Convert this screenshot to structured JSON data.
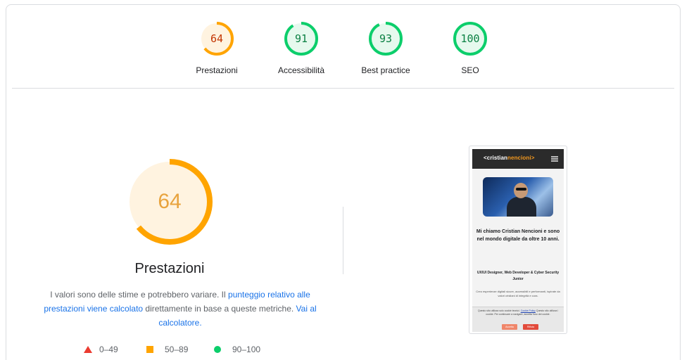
{
  "gauges": [
    {
      "id": "performance",
      "score": "64",
      "label": "Prestazioni",
      "rating": "average",
      "fraction": 0.64
    },
    {
      "id": "accessibility",
      "score": "91",
      "label": "Accessibilità",
      "rating": "pass",
      "fraction": 0.91
    },
    {
      "id": "best-practices",
      "score": "93",
      "label": "Best practice",
      "rating": "pass",
      "fraction": 0.93
    },
    {
      "id": "seo",
      "score": "100",
      "label": "SEO",
      "rating": "pass",
      "fraction": 1.0
    }
  ],
  "colors": {
    "average_stroke": "#ffa400",
    "average_fill": "#fff3e0",
    "average_text": "#c33300",
    "pass_stroke": "#0cce6b",
    "pass_fill": "#e6f9ee",
    "pass_text": "#0b8043",
    "fail": "#eb3b30",
    "link": "#1a73e8"
  },
  "main": {
    "score": "64",
    "fraction": 0.64,
    "title": "Prestazioni",
    "description": {
      "part1": "I valori sono delle stime e potrebbero variare. Il ",
      "link1": "punteggio relativo alle prestazioni viene calcolato",
      "part2": " direttamente in base a queste metriche. ",
      "link2": "Vai al calcolatore."
    }
  },
  "legend": [
    {
      "icon": "triangle-icon",
      "range": "0–49"
    },
    {
      "icon": "square-icon",
      "range": "50–89"
    },
    {
      "icon": "circle-icon",
      "range": "90–100"
    }
  ],
  "screenshot": {
    "logo_part1": "<cristian",
    "logo_part2": "nencioni>",
    "heading": "Mi chiamo Cristian Nencioni e sono nel mondo digitale da oltre 10 anni.",
    "role": "UX/UI Designer, Web Developer & Cyber Security Junior",
    "intro": "Creo esperienze digitali sicure, accessibili e performanti, ispirate da valori cristiani di integrità e cura.",
    "cookie_text_1": "Questo sito utilizza solo cookie tecnici. ",
    "cookie_link": "Cookie Policy",
    "cookie_text_2": "Questo sito utilizza i cookie. Per continuare a navigare, accetta l'uso dei cookie.",
    "accept_label": "Accetta",
    "reject_label": "Rifiuta"
  }
}
